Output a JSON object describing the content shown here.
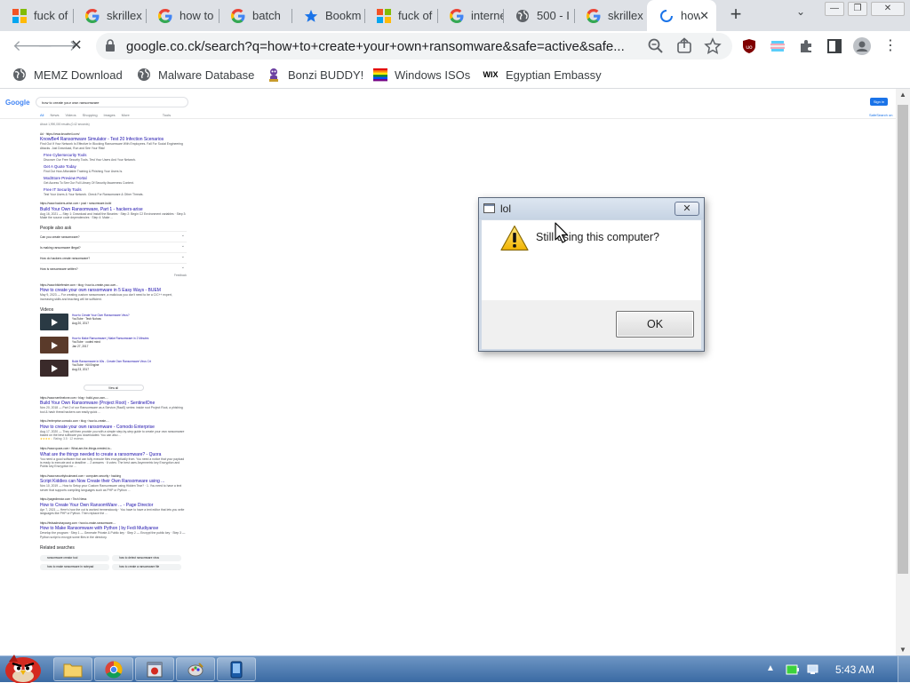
{
  "browser": {
    "tabs": [
      {
        "title": "fuck of",
        "favicon": "microsoft-icon"
      },
      {
        "title": "skrillex",
        "favicon": "google-icon"
      },
      {
        "title": "how to",
        "favicon": "google-icon"
      },
      {
        "title": "batch",
        "favicon": "google-icon"
      },
      {
        "title": "Bookm",
        "favicon": "star-icon"
      },
      {
        "title": "fuck of",
        "favicon": "microsoft-icon"
      },
      {
        "title": "interne",
        "favicon": "google-icon"
      },
      {
        "title": "500 - I",
        "favicon": "globe-icon"
      },
      {
        "title": "skrillex",
        "favicon": "google-icon"
      },
      {
        "title": "how",
        "favicon": "loading-icon",
        "active": true
      }
    ],
    "new_tab_label": "+",
    "url": "google.co.ck/search?q=how+to+create+your+own+ransomware&safe=active&safe...",
    "bookmarks": [
      {
        "label": "MEMZ Download",
        "icon": "globe-icon"
      },
      {
        "label": "Malware Database",
        "icon": "globe-icon"
      },
      {
        "label": "Bonzi BUDDY!",
        "icon": "bonzi-icon"
      },
      {
        "label": "Windows ISOs",
        "icon": "rainbow-flag-icon"
      },
      {
        "label": "Egyptian Embassy",
        "icon": "wix-icon"
      }
    ],
    "bookmark_wix_text": "WIX"
  },
  "google": {
    "logo": "Google",
    "query": "how to create your own ransomware",
    "nav": [
      "All",
      "News",
      "Videos",
      "Shopping",
      "Images",
      "More",
      "Tools"
    ],
    "sign_in": "Sign in",
    "settings": "SafeSearch on",
    "result_count": "About 1,990,000 results (0.42 seconds)",
    "results": [
      {
        "url": "Ad · https://www.knowbe4.com/",
        "title": "KnowBe4 Ransomware Simulator - Test 20 Infection Scenarios",
        "snippet": "Find Out If Your Network Is Effective In Blocking Ransomware With Employees. Fall For Social Engineering Attacks. Just Download, Run and See Your Risk!",
        "sublinks": [
          {
            "title": "Free Cybersecurity Tools",
            "desc": "Discover Our Free Security Tools. Test Your Users And Your Network."
          },
          {
            "title": "Get A Quote Today",
            "desc": "Find Out How Affordable Training & Phishing Your Users Is."
          },
          {
            "title": "ModStore Preview Portal",
            "desc": "Get Access To See Our Full Library Of Security Awareness Content."
          },
          {
            "title": "Free IT Security Tools",
            "desc": "Test Your Users & Your Network. Check For Ransomware & Other Threats."
          }
        ]
      },
      {
        "url": "https://www.hackers-arise.com › post › ransomware-build",
        "title": "Build Your Own Ransomware, Part 1 - hackers-arise",
        "snippet": "Aug 16, 2021 — Step 1: Download and Install the Binaries · Step 2: Begin C2 Environment variables · Step 3: Make the source code dependencies · Step 4: Make ..."
      }
    ],
    "paa_heading": "People also ask",
    "paa": [
      "Can you create ransomware?",
      "Is making ransomware illegal?",
      "How do hackers create ransomware?",
      "How is ransomware written?"
    ],
    "feedback": "Feedback",
    "results2": [
      {
        "url": "https://www.bitdefender.com › blog › how-to-create-your-own...",
        "title": "How to create your own ransomware in 5 Easy Ways - BUEM",
        "snippet": "May 9, 2023 — For creating custom ransomware, a malicious you don't need to be a C/C++ expert, increasing skills and teaching will be sufficient."
      }
    ],
    "videos_heading": "Videos",
    "videos": [
      {
        "title": "How to Create Your Own Ransomware Virus?",
        "meta": "YouTube · Tech Nohow",
        "date": "Aug 20, 2017"
      },
      {
        "title": "How to Make Ransomware | Make Ransomware in 2 Minutes",
        "meta": "YouTube · coded mind",
        "date": "Jan 27, 2017"
      },
      {
        "title": "Build Ransomware in 60s - Create Own Ransomware Virus Crt",
        "meta": "YouTube · Kill Engine",
        "date": "Aug 23, 2017"
      }
    ],
    "view_all": "View all",
    "results3": [
      {
        "url": "https://www.sentinelone.com › blog › build-your-own-...",
        "title": "Build Your Own Ransomware (Project Root) - SentinelOne",
        "snippet": "Nov 20, 2018 — Part 2 of our Ransomware as a Service (RaaS) series: inside root Project Root, a phishing tool & hash threat hackers can easily quick ..."
      },
      {
        "url": "https://enterprise.comodo.com › blog › how-to-create-...",
        "title": "How to create your own ransomware - Comodo Enterprise",
        "snippet": "Aug 17, 2020 — They will then provide you with a simple step-by-step guide to create your own ransomware based on the best software you downloaded. You can also ...",
        "rating": "Rating: 3.5 · 12 reviews"
      },
      {
        "url": "https://www.quora.com › What-are-the-things-needed-to...",
        "title": "What are the things needed to create a ransomware? - Quora",
        "snippet": "You need a good software that can fully execute files encryptically from. You need a notice that your payload is ready to execute and a deadline ...  2 answers · 6 votes: The best uses Asymmetric key Encryption and Public key Encryption for ..."
      },
      {
        "url": "https://www.securityboulevard.com › computer-security › hacking",
        "title": "Script Kiddies can Now Create their Own Ransomware using ...",
        "snippet": "Nov 10, 2019 — How to Setup your Custom Ransomware using Hidden Tear? · 1. You need to have a text server that supports compiling languages such as PHP or Python ..."
      },
      {
        "url": "https://pagedirector.com › Tech News",
        "title": "How to Create Your Own RansomWare ... - Page Director",
        "snippet": "Apr 7, 2021 — Here's how the cut is worked tremendously · You have to have a text editor that lets you write languages like PHP or Python. Then replace the ..."
      },
      {
        "url": "https://fedsadeuhayoung.com › how-to-make-ransomware-...",
        "title": "How to Make Ransomware with Python | by Fedi Mudiyanse",
        "snippet": "Develop the program · Step 1 — Generate Private & Public key · Step 2 — Encrypt the public key · Step 3 — Python script to encrypt some files in the directory."
      }
    ],
    "related_heading": "Related searches",
    "related": [
      "ransomware creator tool",
      "how to detect ransomware virus",
      "how to make ransomware in notepad",
      "how to create a ransomware file"
    ]
  },
  "dialog": {
    "title": "lol",
    "message": "Still using this computer?",
    "ok": "OK",
    "close": "✕"
  },
  "taskbar": {
    "clock": "5:43 AM",
    "tray_arrow": "▲"
  }
}
